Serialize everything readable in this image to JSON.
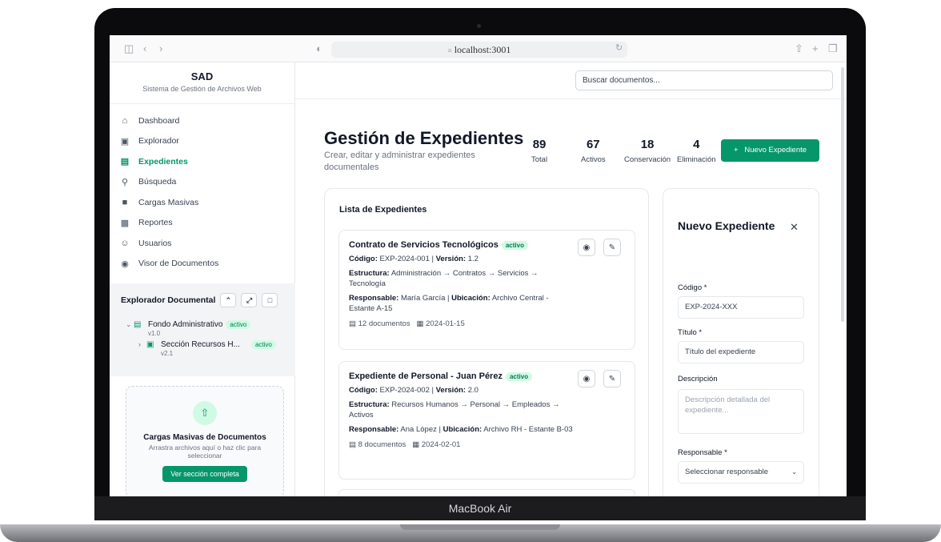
{
  "device": {
    "label": "MacBook Air"
  },
  "browser": {
    "url": "localhost:3001",
    "lock": "≡"
  },
  "sidebar": {
    "title": "SAD",
    "subtitle": "Sistema de Gestión de Archivos Web",
    "items": [
      {
        "label": "Dashboard",
        "icon": "home-icon"
      },
      {
        "label": "Explorador",
        "icon": "folder-icon"
      },
      {
        "label": "Expedientes",
        "icon": "database-icon",
        "active": true
      },
      {
        "label": "Búsqueda",
        "icon": "search-icon"
      },
      {
        "label": "Cargas Masivas",
        "icon": "file-upload-icon"
      },
      {
        "label": "Reportes",
        "icon": "clipboard-icon"
      },
      {
        "label": "Usuarios",
        "icon": "users-icon"
      },
      {
        "label": "Visor de Documentos",
        "icon": "eye-icon"
      }
    ],
    "explorer": {
      "title": "Explorador Documental",
      "nodes": [
        {
          "name": "Fondo Administrativo",
          "version": "v1.0",
          "status": "activo"
        },
        {
          "name": "Sección Recursos H...",
          "version": "v2.1",
          "status": "activo"
        }
      ]
    },
    "upload": {
      "title": "Cargas Masivas de Documentos",
      "description": "Arrastra archivos aquí o haz clic para seleccionar",
      "button": "Ver sección completa"
    }
  },
  "header": {
    "search_placeholder": "Buscar documentos..."
  },
  "main": {
    "title": "Gestión de Expedientes",
    "subtitle": "Crear, editar y administrar expedientes documentales",
    "stats": [
      {
        "value": "89",
        "label": "Total"
      },
      {
        "value": "67",
        "label": "Activos"
      },
      {
        "value": "18",
        "label": "Conservación"
      },
      {
        "value": "4",
        "label": "Eliminación"
      }
    ],
    "new_button": "Nuevo Expediente",
    "list": {
      "title": "Lista de Expedientes",
      "labels": {
        "code": "Código:",
        "version": "Versión:",
        "structure": "Estructura:",
        "responsible": "Responsable:",
        "location": "Ubicación:"
      },
      "cards": [
        {
          "title": "Contrato de Servicios Tecnológicos",
          "status": "activo",
          "code": "EXP-2024-001",
          "version": "1.2",
          "structure": "Administración → Contratos → Servicios → Tecnología",
          "responsible": "María García",
          "location": "Archivo Central - Estante A-15",
          "documents": "12 documentos",
          "date": "2024-01-15"
        },
        {
          "title": "Expediente de Personal - Juan Pérez",
          "status": "activo",
          "code": "EXP-2024-002",
          "version": "2.0",
          "structure": "Recursos Humanos → Personal → Empleados → Activos",
          "responsible": "Ana López",
          "location": "Archivo RH - Estante B-03",
          "documents": "8 documentos",
          "date": "2024-02-01"
        }
      ]
    },
    "form": {
      "title": "Nuevo Expediente",
      "fields": {
        "code_label": "Código *",
        "code_placeholder": "EXP-2024-XXX",
        "title_label": "Título *",
        "title_placeholder": "Título del expediente",
        "description_label": "Descripción",
        "description_placeholder": "Descripción detallada del expediente...",
        "responsible_label": "Responsable *",
        "responsible_value": "Seleccionar responsable"
      }
    }
  }
}
